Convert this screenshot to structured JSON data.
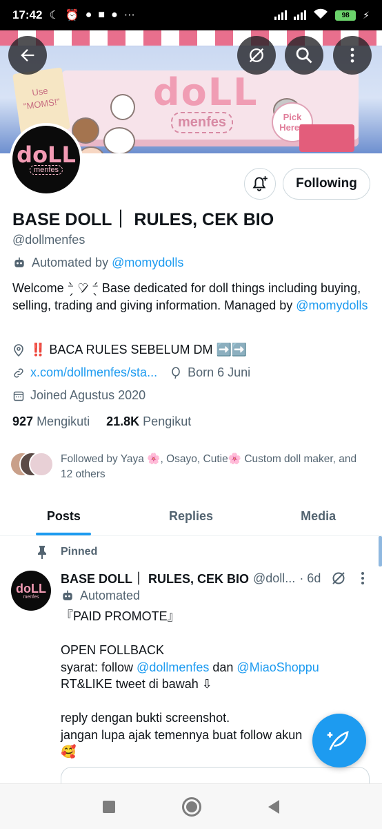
{
  "status_bar": {
    "time": "17:42",
    "notif_icons": [
      "moon-icon",
      "alarm-icon",
      "chat-icon",
      "square-icon",
      "line-icon",
      "more-dots"
    ],
    "battery": "98"
  },
  "banner": {
    "note_text": "Use \"MOMS!\"",
    "logo_big": "doLL",
    "logo_small": "menfes",
    "pick_text": "Pick Here!!"
  },
  "header": {
    "back_icon": "arrow-left-icon",
    "grok_icon": "grok-icon",
    "search_icon": "search-icon",
    "more_icon": "more-vertical-icon"
  },
  "profile": {
    "avatar_big": "doLL",
    "avatar_small": "menfes",
    "follow_button": "Following",
    "display_name": "BASE DOLL｜ RULES, CEK BIO",
    "handle": "@dollmenfes",
    "automated_prefix": "Automated by ",
    "automated_by": "@momydolls",
    "bio_text": "Welcome ⁻̗̀ ♡̷ ⁻̖́ Base dedicated for doll things including buying, selling, trading and giving information. Managed by ",
    "bio_mention": "@momydolls",
    "location_emoji": "‼️",
    "location_text": " BACA RULES SEBELUM DM ➡️➡️",
    "website": "x.com/dollmenfes/sta...",
    "born": "Born 6 Juni",
    "joined": "Joined Agustus 2020",
    "following_count": "927",
    "following_label": "Mengikuti",
    "followers_count": "21.8K",
    "followers_label": "Pengikut",
    "followed_by": "Followed by Yaya 🌸, Osayo, Cutie🌸 Custom doll maker, and 12 others"
  },
  "tabs": [
    {
      "label": "Posts",
      "active": true
    },
    {
      "label": "Replies",
      "active": false
    },
    {
      "label": "Media",
      "active": false
    }
  ],
  "tweet": {
    "pinned_label": "Pinned",
    "author_name": "BASE DOLL｜ RULES, CEK BIO",
    "author_handle": "@doll...",
    "time": "· 6d",
    "automated_label": "Automated",
    "line1": "『PAID PROMOTE』",
    "line2": "",
    "line3": "OPEN FOLLBACK",
    "line4_prefix": "syarat: follow ",
    "line4_m1": "@dollmenfes",
    "line4_mid": " dan ",
    "line4_m2": "@MiaoShoppu",
    "line5": "RT&LIKE tweet di bawah ⇩",
    "line6": "",
    "line7": "reply dengan bukti screenshot.",
    "line8": "jangan lupa ajak temennya buat follow akun",
    "line9": "🥰"
  },
  "colors": {
    "accent": "#1d9bf0",
    "text_primary": "#0f1419",
    "text_secondary": "#536471"
  }
}
